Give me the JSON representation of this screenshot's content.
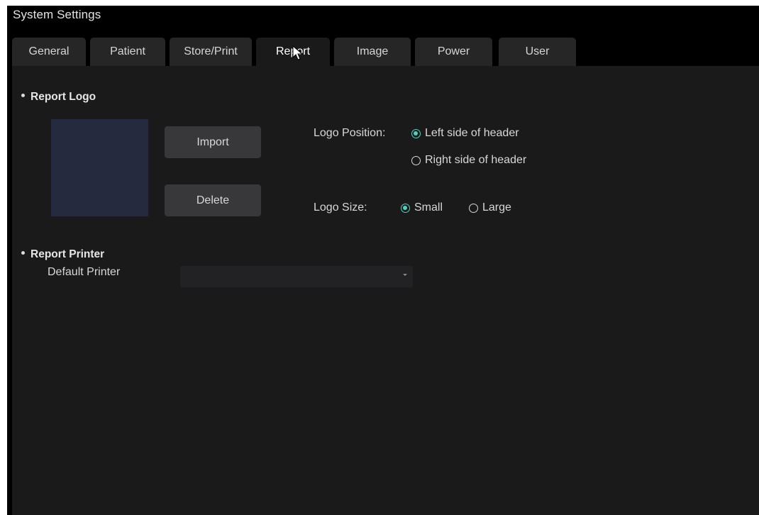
{
  "window": {
    "title": "System Settings"
  },
  "tabs": [
    {
      "label": "General",
      "active": false
    },
    {
      "label": "Patient",
      "active": false
    },
    {
      "label": "Store/Print",
      "active": false
    },
    {
      "label": "Report",
      "active": true
    },
    {
      "label": "Image",
      "active": false
    },
    {
      "label": "Power",
      "active": false
    },
    {
      "label": "User",
      "active": false
    }
  ],
  "report_logo": {
    "section_title": "Report Logo",
    "import_label": "Import",
    "delete_label": "Delete",
    "position_label": "Logo Position:",
    "position_options": [
      {
        "label": "Left side of header",
        "checked": true
      },
      {
        "label": "Right side of header",
        "checked": false
      }
    ],
    "size_label": "Logo Size:",
    "size_options": [
      {
        "label": "Small",
        "checked": true
      },
      {
        "label": "Large",
        "checked": false
      }
    ]
  },
  "report_printer": {
    "section_title": "Report Printer",
    "default_printer_label": "Default Printer",
    "default_printer_value": ""
  },
  "colors": {
    "accent": "#4fd1c0",
    "background": "#1a1a1a",
    "tab": "#262626",
    "logo_preview": "#262a3e"
  },
  "icons": {
    "dropdown": "chevron-down-icon",
    "cursor": "cursor-icon",
    "bullet": "bullet-icon"
  }
}
